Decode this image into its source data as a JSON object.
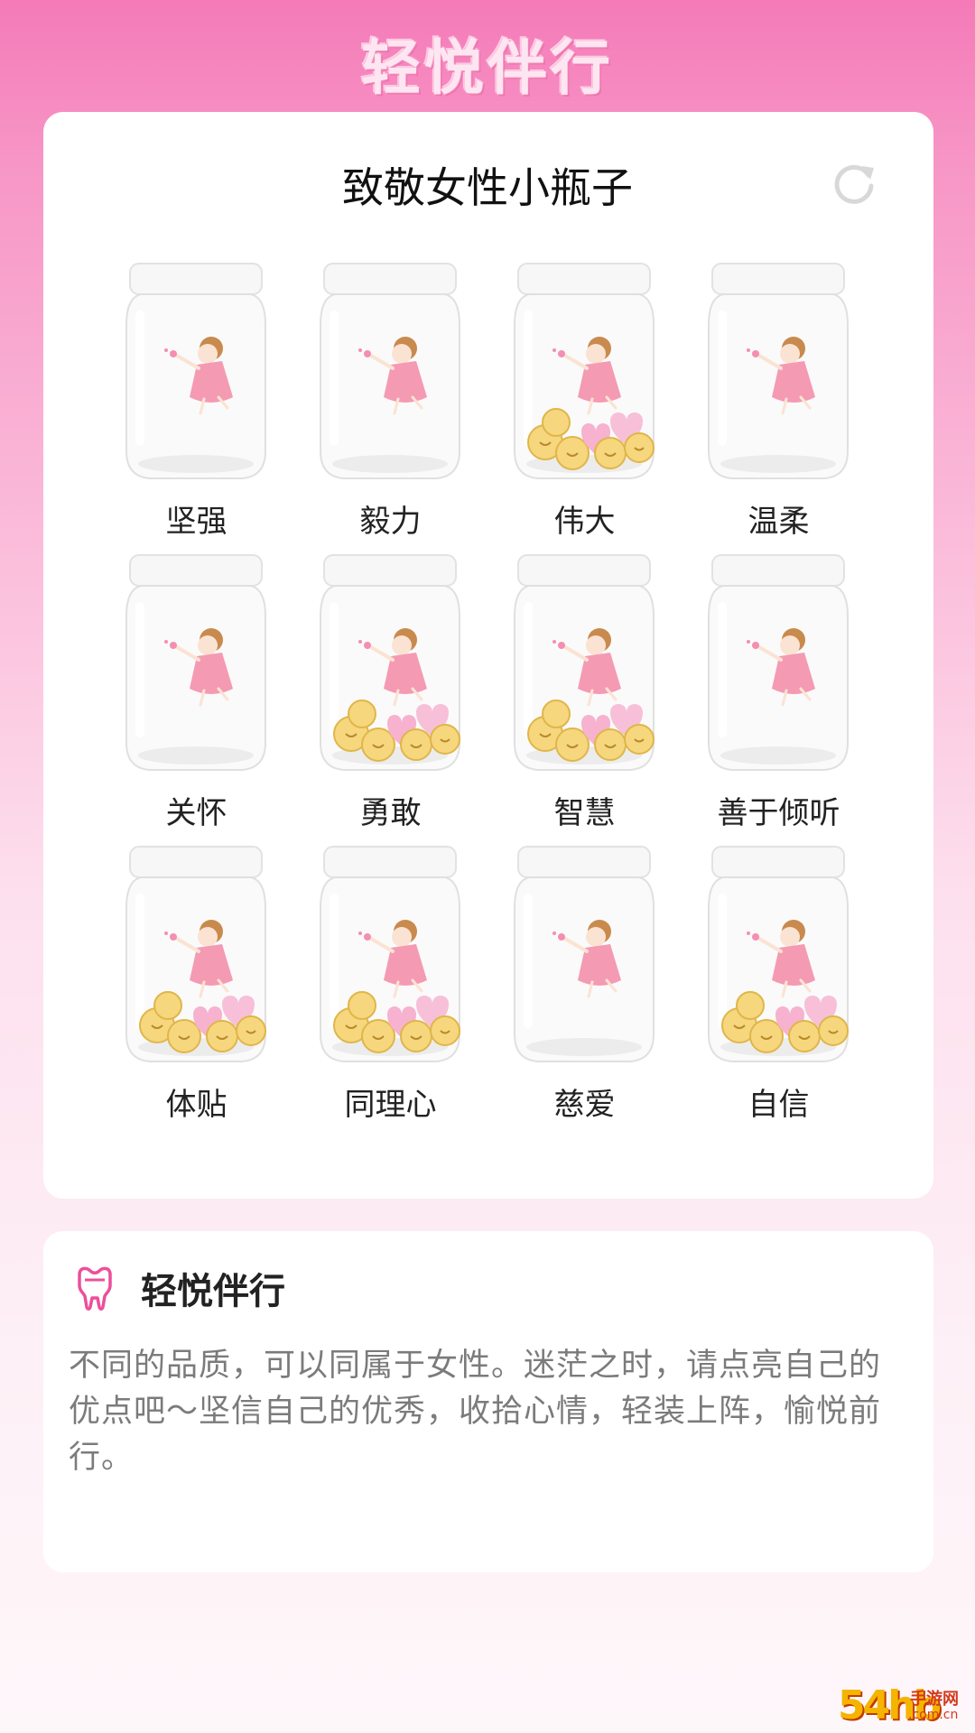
{
  "header": {
    "title": "轻悦伴行"
  },
  "jar_card": {
    "title": "致敬女性小瓶子",
    "refresh_icon": "refresh-icon",
    "jars": [
      {
        "label": "坚强",
        "filled": false
      },
      {
        "label": "毅力",
        "filled": false
      },
      {
        "label": "伟大",
        "filled": true
      },
      {
        "label": "温柔",
        "filled": false
      },
      {
        "label": "关怀",
        "filled": false
      },
      {
        "label": "勇敢",
        "filled": true
      },
      {
        "label": "智慧",
        "filled": true
      },
      {
        "label": "善于倾听",
        "filled": false
      },
      {
        "label": "体贴",
        "filled": true
      },
      {
        "label": "同理心",
        "filled": true
      },
      {
        "label": "慈爱",
        "filled": false
      },
      {
        "label": "自信",
        "filled": true
      }
    ]
  },
  "info_card": {
    "icon": "tooth-icon",
    "title": "轻悦伴行",
    "body": "不同的品质，可以同属于女性。迷茫之时，请点亮自己的优点吧～坚信自己的优秀，收拾心情，轻装上阵，愉悦前行。"
  },
  "watermark": {
    "brand": "54hb",
    "text": "手游网",
    "domain": ".com.cn"
  },
  "colors": {
    "accent": "#f47ab8",
    "icon_pink": "#ec4f9a",
    "refresh_gray": "#d8d8d8"
  }
}
